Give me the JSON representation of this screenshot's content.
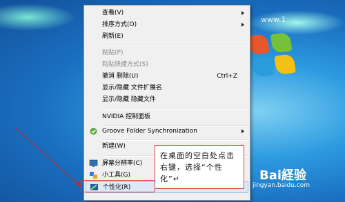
{
  "menu": {
    "items": [
      {
        "label": "查看(V)",
        "submenu": true
      },
      {
        "label": "排序方式(O)",
        "submenu": true
      },
      {
        "label": "刷新(E)"
      },
      {
        "label": "粘贴(P)",
        "disabled": true
      },
      {
        "label": "粘贴快捷方式(S)",
        "disabled": true
      },
      {
        "label": "撤消 删除(U)",
        "shortcut": "Ctrl+Z"
      },
      {
        "label": "显示/隐藏 文件扩展名"
      },
      {
        "label": "显示/隐藏 隐藏文件"
      },
      {
        "label": "NVIDIA 控制面板"
      },
      {
        "label": "Groove Folder Synchronization",
        "submenu": true
      },
      {
        "label": "新建(W)",
        "submenu": true
      },
      {
        "label": "屏幕分辨率(C)"
      },
      {
        "label": "小工具(G)"
      },
      {
        "label": "个性化(R)",
        "highlighted": true
      }
    ]
  },
  "callout": {
    "text": "在桌面的空白处点击右键，选择“个性化”↵"
  },
  "watermark": {
    "brand": "Bai経验",
    "url": "jingyan.baidu.com",
    "top": "www.1"
  },
  "colors": {
    "highlight": "#e03a3a",
    "menu_bg": "#f0f0f0"
  }
}
